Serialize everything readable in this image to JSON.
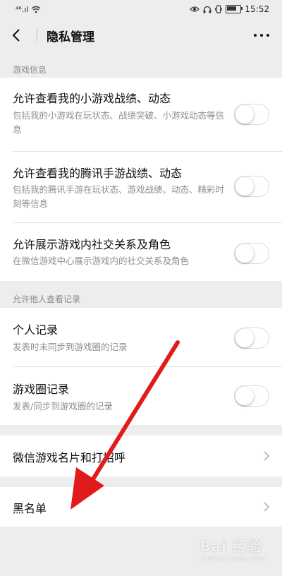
{
  "status_bar": {
    "signal": "⁴⁶.ıl",
    "time": "15:52"
  },
  "nav": {
    "title": "隐私管理"
  },
  "sections": {
    "game_info_header": "游戏信息",
    "others_view_header": "允许他人查看记录"
  },
  "toggles": [
    {
      "title": "允许查看我的小游戏战绩、动态",
      "desc": "包括我的小游戏在玩状态、战绩突破、小游戏动态等信息",
      "on": false
    },
    {
      "title": "允许查看我的腾讯手游战绩、动态",
      "desc": "包括我的腾讯手游在玩状态、游戏战绩、动态、精彩时刻等信息",
      "on": false
    },
    {
      "title": "允许展示游戏内社交关系及角色",
      "desc": "在微信游戏中心展示游戏内的社交关系及角色",
      "on": false
    },
    {
      "title": "个人记录",
      "desc": "发表时未同步到游戏圈的记录",
      "on": false
    },
    {
      "title": "游戏圈记录",
      "desc": "发表/同步到游戏圈的记录",
      "on": false
    }
  ],
  "links": [
    {
      "label": "微信游戏名片和打招呼"
    },
    {
      "label": "黑名单"
    }
  ],
  "annotation": {
    "arrow_color": "#e11b1b"
  },
  "watermark": {
    "text": "Bai 经验",
    "sub": "jingyan.baidu.com"
  }
}
